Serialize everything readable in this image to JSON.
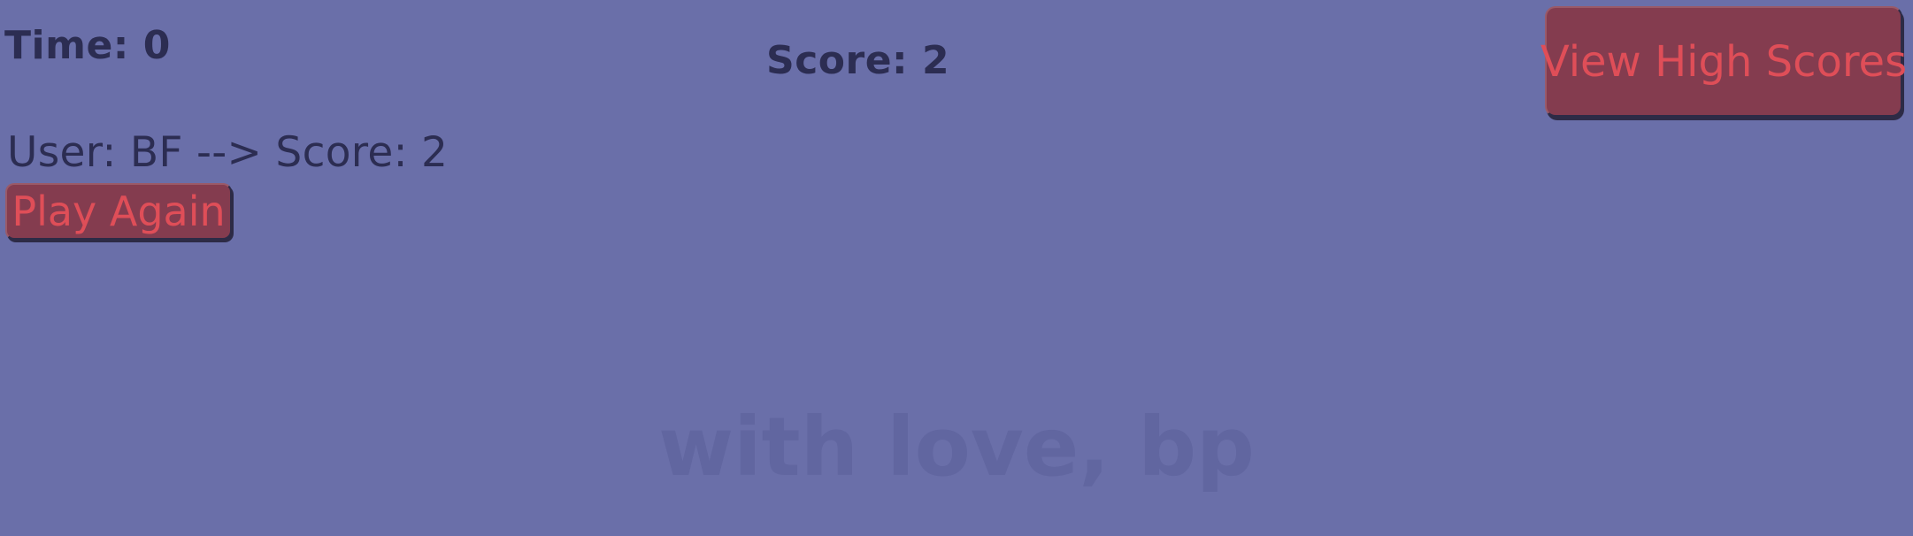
{
  "hud": {
    "timer": "Time: 0",
    "score": "Score: 2"
  },
  "buttons": {
    "view_high_scores": "View High Scores",
    "play_again": "Play Again"
  },
  "result": {
    "line": "User: BF --> Score: 2"
  },
  "footer": {
    "signature": "with love, bp"
  },
  "colors": {
    "background": "#6a6fa9",
    "text": "#2c2d52",
    "button_fill": "#843c4f",
    "button_text": "#df4e58",
    "signature": "#6166a0"
  }
}
